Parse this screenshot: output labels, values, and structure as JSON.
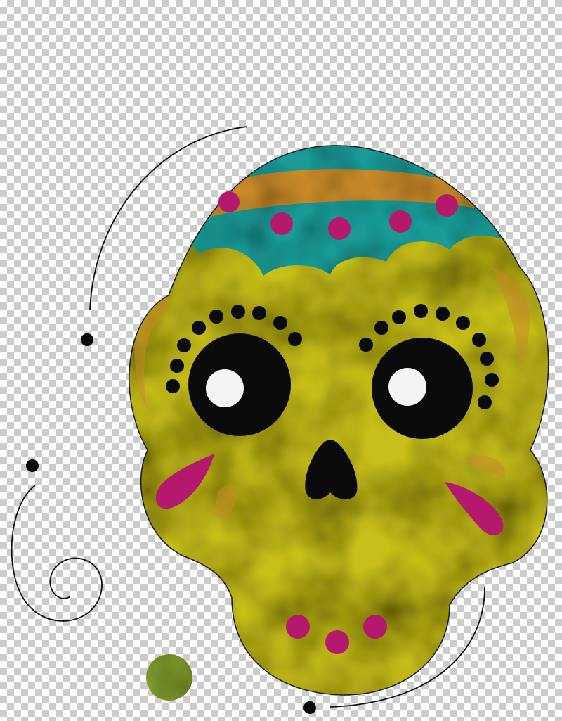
{
  "artwork": {
    "subject": "sugar-skull",
    "colors": {
      "skull_base": "#c8bf1e",
      "skull_dark": "#7d7a10",
      "skull_light": "#e6df35",
      "headband_teal": "#1f9a96",
      "band_orange": "#c98a2a",
      "magenta": "#b5196e",
      "black": "#0a0a0a",
      "white": "#f4f4f4",
      "green_dot": "#7f9a2e",
      "outline": "#1a1a1a",
      "checker_light": "#ffffff",
      "checker_dark": "#cccccc"
    }
  }
}
